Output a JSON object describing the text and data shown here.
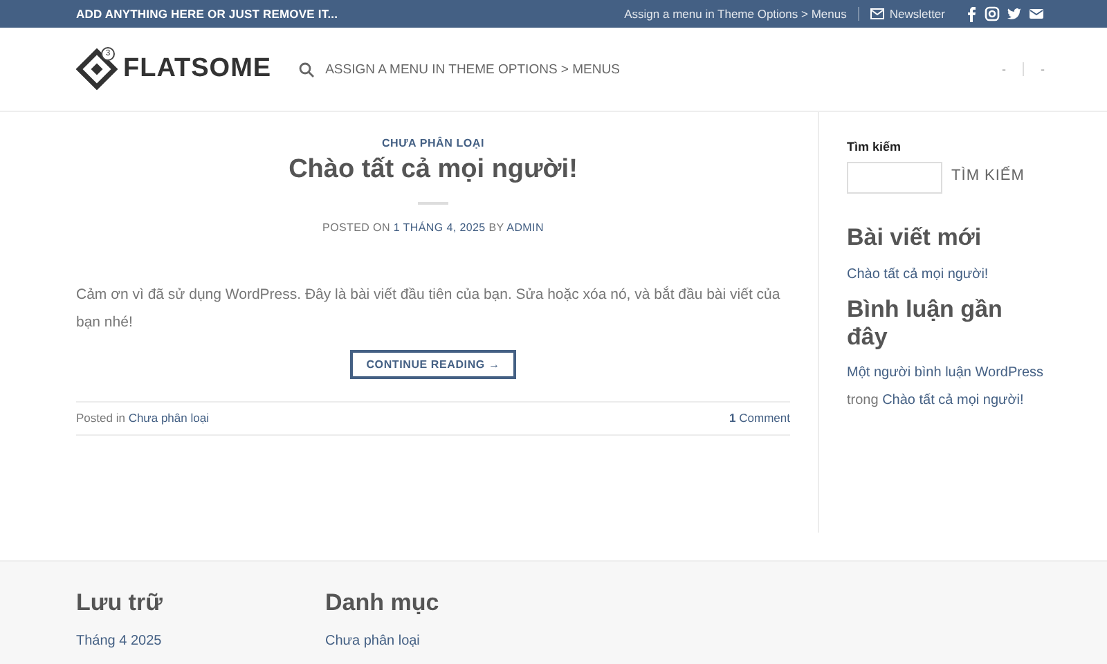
{
  "top_bar": {
    "left_text": "ADD ANYTHING HERE OR JUST REMOVE IT...",
    "menu_link": "Assign a menu in Theme Options > Menus",
    "newsletter": "Newsletter",
    "social": [
      {
        "kind": "facebook"
      },
      {
        "kind": "instagram"
      },
      {
        "kind": "twitter"
      },
      {
        "kind": "email"
      }
    ]
  },
  "header": {
    "logo_text": "FLATSOME",
    "logo_badge": "3",
    "nav_text": "ASSIGN A MENU IN THEME OPTIONS > MENUS",
    "right_items": [
      "-",
      "-"
    ]
  },
  "post": {
    "category": "CHƯA PHÂN LOẠI",
    "title": "Chào tất cả mọi người!",
    "meta": {
      "prefix": "POSTED ON",
      "date": "1 THÁNG 4, 2025",
      "by": "BY",
      "author": "ADMIN"
    },
    "excerpt": "Cảm ơn vì đã sử dụng WordPress. Đây là bài viết đầu tiên của bạn. Sửa hoặc xóa nó, và bắt đầu bài viết của bạn nhé!",
    "button": "CONTINUE READING →",
    "footer": {
      "posted_in": "Posted in",
      "category": "Chưa phân loại",
      "comment_count": "1",
      "comment_label": "Comment"
    }
  },
  "sidebar": {
    "search_label": "Tìm kiếm",
    "search_button": "TÌM KIẾM",
    "recent_posts": {
      "title": "Bài viết mới",
      "items": [
        "Chào tất cả mọi người!"
      ]
    },
    "recent_comments": {
      "title": "Bình luận gần đây",
      "items": [
        {
          "author": "Một người bình luận WordPress",
          "connector": "trong",
          "post": "Chào tất cả mọi người!"
        }
      ]
    }
  },
  "footer": {
    "widgets": [
      {
        "title": "Lưu trữ",
        "items": [
          "Tháng 4 2025"
        ]
      },
      {
        "title": "Danh mục",
        "items": [
          "Chưa phân loại"
        ]
      }
    ]
  }
}
